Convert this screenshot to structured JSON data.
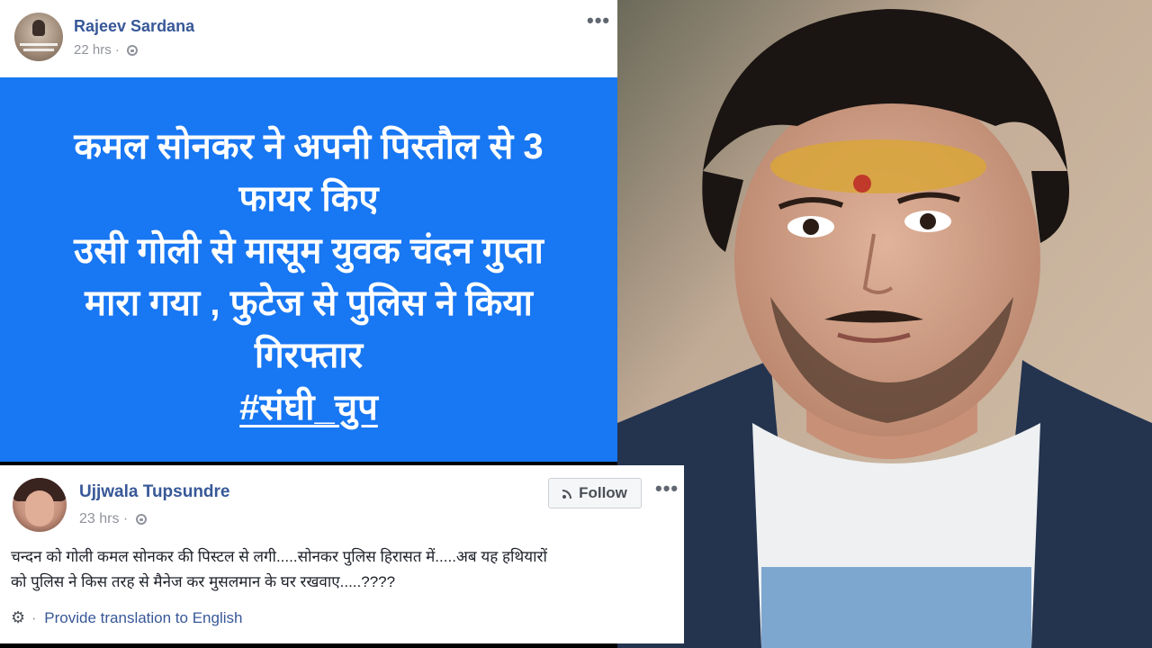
{
  "post1": {
    "author": "Rajeev Sardana",
    "time": "22 hrs",
    "separator": "·",
    "more": "•••",
    "lines": [
      "कमल सोनकर ने अपनी पिस्तौल से 3",
      "फायर किए",
      "उसी गोली से मासूम युवक चंदन गुप्ता",
      "मारा गया , फुटेज से पुलिस ने किया",
      "गिरफ्तार"
    ],
    "hashtag": "#संघी_चुप",
    "background_color": "#1877f2"
  },
  "post2": {
    "author": "Ujjwala Tupsundre",
    "time": "23 hrs",
    "separator": "·",
    "follow_label": "Follow",
    "more": "•••",
    "body_line1": "चन्दन को गोली कमल सोनकर की पिस्टल से लगी.....सोनकर पुलिस हिरासत में.....अब यह हथियारों",
    "body_line2": "को पुलिस ने किस तरह से मैनेज कर मुसलमान के घर रखवाए.....????",
    "translate_separator": "·",
    "translate_label": "Provide translation to English"
  },
  "icons": {
    "globe": "globe-icon",
    "gear": "gear-icon",
    "rss": "rss-icon"
  },
  "colors": {
    "link_blue": "#385898",
    "meta_gray": "#90949c"
  }
}
